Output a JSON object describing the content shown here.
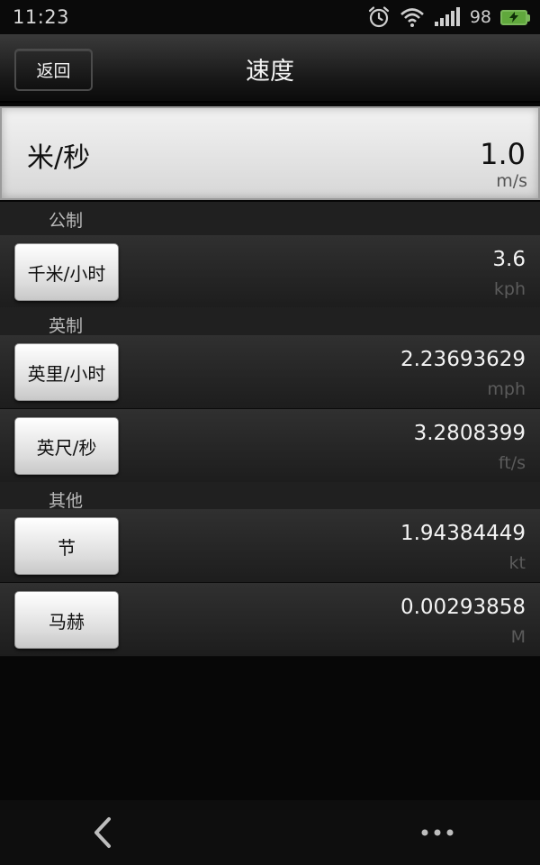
{
  "status": {
    "time": "11:23",
    "battery_percent": "98",
    "icons": [
      "alarm-icon",
      "wifi-icon",
      "signal-icon",
      "battery-icon"
    ]
  },
  "header": {
    "back_label": "返回",
    "title": "速度"
  },
  "base_unit": {
    "name": "米/秒",
    "value": "1.0",
    "unit": "m/s"
  },
  "sections": [
    {
      "title": "公制",
      "rows": [
        {
          "label": "千米/小时",
          "value": "3.6",
          "unit": "kph"
        }
      ]
    },
    {
      "title": "英制",
      "rows": [
        {
          "label": "英里/小时",
          "value": "2.23693629",
          "unit": "mph"
        },
        {
          "label": "英尺/秒",
          "value": "3.2808399",
          "unit": "ft/s"
        }
      ]
    },
    {
      "title": "其他",
      "rows": [
        {
          "label": "节",
          "value": "1.94384449",
          "unit": "kt"
        },
        {
          "label": "马赫",
          "value": "0.00293858",
          "unit": "M"
        }
      ]
    }
  ],
  "colors": {
    "background": "#070707",
    "battery_green": "#60a83c",
    "card_light": "#f2f2f2"
  },
  "bottom_nav": {
    "icons": [
      "chevron-left-icon",
      "more-icon"
    ]
  }
}
